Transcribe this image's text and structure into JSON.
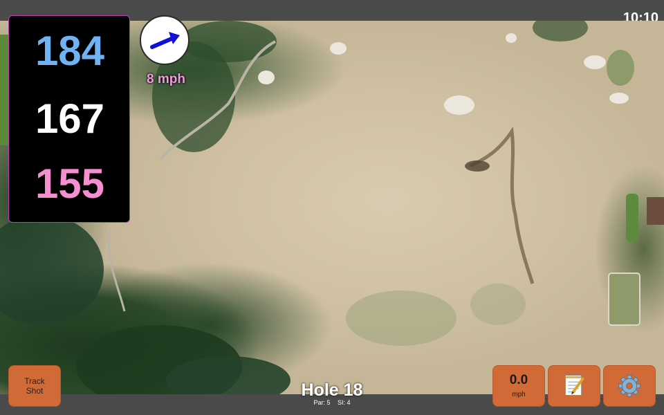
{
  "status_bar": {
    "time": "10:10"
  },
  "yardages": {
    "back": "184",
    "middle": "167",
    "front": "155"
  },
  "wind": {
    "speed": "8 mph",
    "icon": "wind-direction-arrow-icon"
  },
  "hole": {
    "title": "Hole 18",
    "par": "Par: 5",
    "stroke_index": "SI: 4"
  },
  "buttons": {
    "track_shot": "Track\nShot",
    "speed_value": "0.0",
    "speed_unit": "mph",
    "notes_icon": "notepad-icon",
    "settings_icon": "gear-icon"
  },
  "colors": {
    "back_yardage": "#6fb3f5",
    "middle_yardage": "#ffffff",
    "front_yardage": "#f58fcf",
    "button": "#d16a36",
    "wind_label": "#f49be0"
  }
}
